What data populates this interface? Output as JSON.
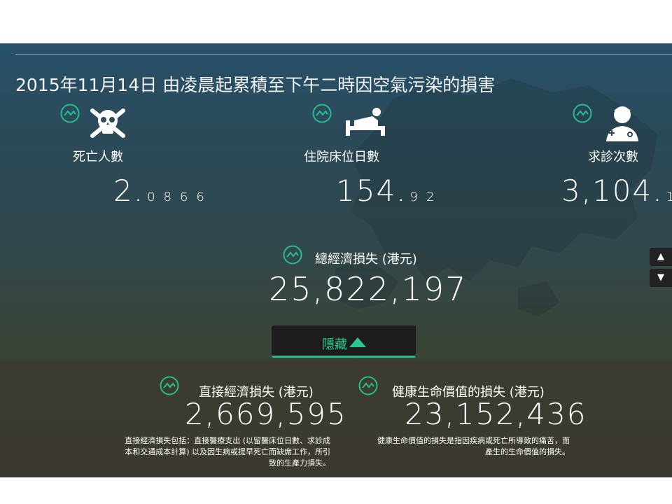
{
  "title": "2015年11月14日 由凌晨起累積至下午二時因空氣污染的損害",
  "stats": [
    {
      "label": "死亡人數",
      "value_main": "2.",
      "value_tail": "0866",
      "icon": "skull-icon"
    },
    {
      "label": "住院床位日數",
      "value_main": "154.",
      "value_tail": "92",
      "icon": "hospital-bed-icon"
    },
    {
      "label": "求診次數",
      "value_main": "3,104.",
      "value_tail": "1",
      "icon": "doctor-icon"
    }
  ],
  "total": {
    "label": "總經濟損失 (港元)",
    "value": "25,822,197"
  },
  "hide_button": {
    "label": "隱藏"
  },
  "direct": {
    "label": "直接經濟損失 (港元)",
    "value": "2,669,595",
    "note": "直接經濟損失包括：直接醫療支出 (以留醫床位日數、求診成本和交通成本計算) 以及因生病或提早死亡而缺席工作，所引致的生產力損失。"
  },
  "health": {
    "label": "健康生命價值的損失 (港元)",
    "value": "23,152,436",
    "note": "健康生命價值的損失是指因疾病或死亡所導致的痛苦，而產生的生命價值的損失。"
  },
  "scroll": {
    "up": "▲",
    "down": "▼"
  },
  "colors": {
    "accent": "#25c08a",
    "text": "#ffffff",
    "button_bg": "#1d1d1d"
  }
}
